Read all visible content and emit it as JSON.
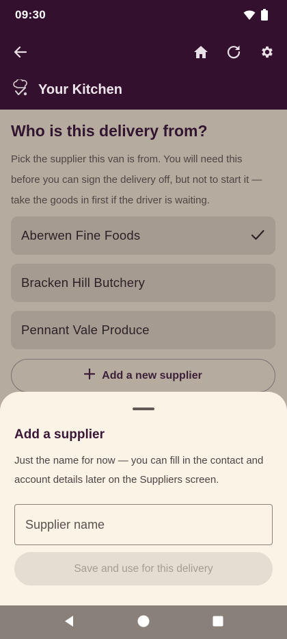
{
  "status_bar": {
    "time": "09:30"
  },
  "toolbar": {
    "back_icon": "arrow-left-icon",
    "home_icon": "home-icon",
    "refresh_icon": "refresh-icon",
    "settings_icon": "gear-icon"
  },
  "kitchen": {
    "title": "Your Kitchen",
    "icon": "chef-hat-icon"
  },
  "main": {
    "question": "Who is this delivery from?",
    "helper": "Pick the supplier this van is from. You will need this before you can sign the delivery off, but not to start it — take the goods in first if the driver is waiting.",
    "options": [
      {
        "label": "Aberwen Fine Foods",
        "selected": true
      },
      {
        "label": "Bracken Hill Butchery",
        "selected": false
      },
      {
        "label": "Pennant Vale Produce",
        "selected": false
      }
    ],
    "add_supplier_label": "Add a new supplier"
  },
  "sheet": {
    "title": "Add a supplier",
    "description": "Just the name for now — you can fill in the contact and account details later on the Suppliers screen.",
    "name_placeholder": "Supplier name",
    "name_value": "",
    "save_label": "Save and use for this delivery",
    "save_enabled": false
  },
  "colors": {
    "appbar": "#33112e",
    "scrim": "#b6ab9f",
    "sheet": "#faf3e6",
    "accent": "#3b1637"
  }
}
